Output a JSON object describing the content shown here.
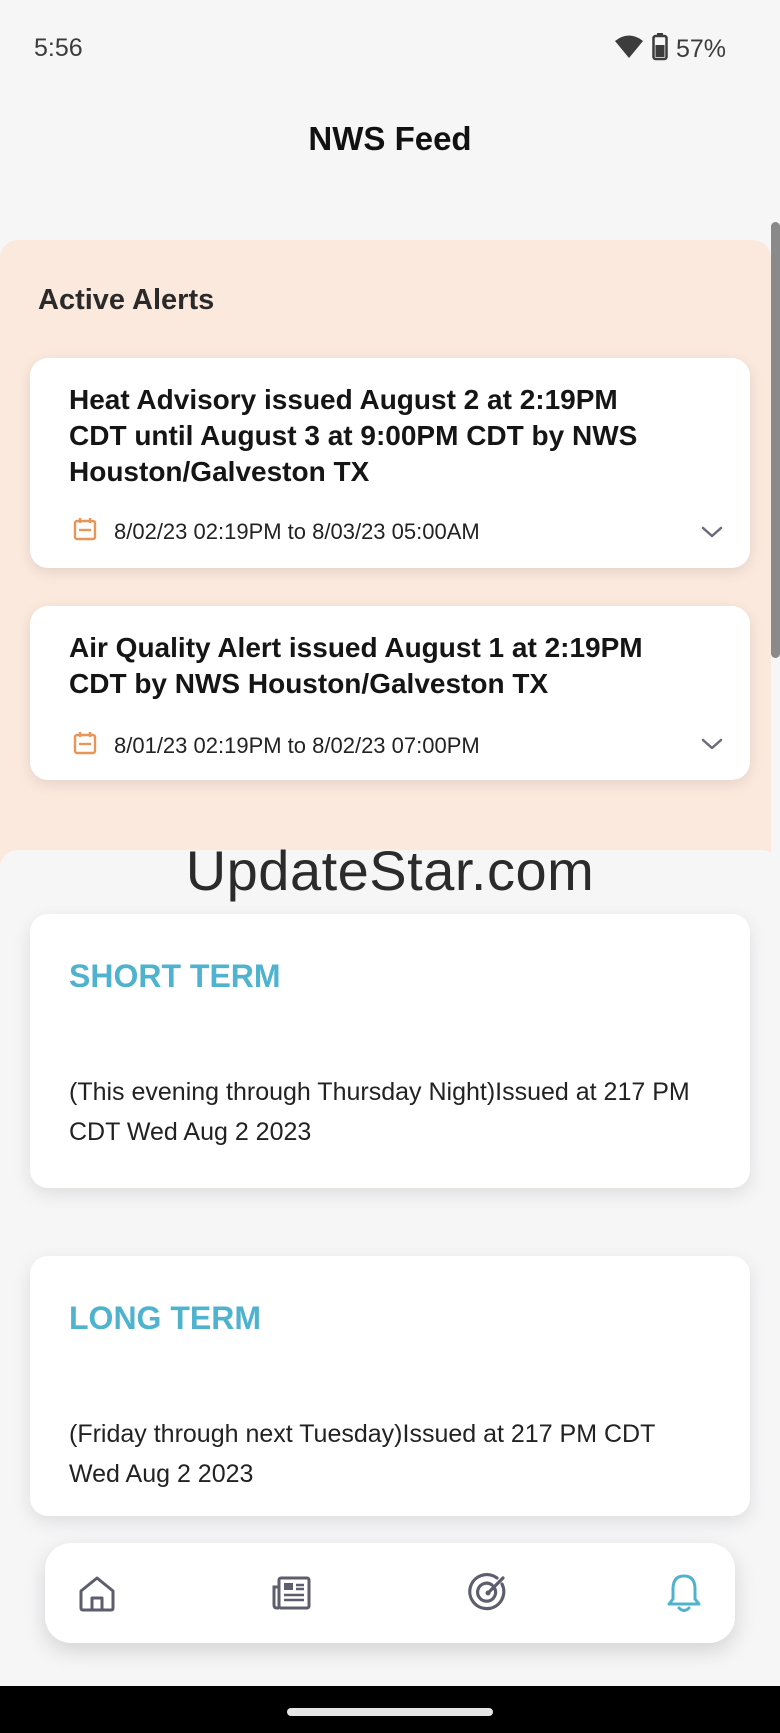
{
  "status_bar": {
    "time": "5:56",
    "battery": "57%"
  },
  "header": {
    "title": "NWS Feed"
  },
  "alerts": {
    "heading": "Active Alerts",
    "items": [
      {
        "title": "Heat Advisory issued August 2 at 2:19PM CDT until August 3 at 9:00PM CDT by NWS Houston/Galveston TX",
        "dates": "8/02/23 02:19PM to 8/03/23 05:00AM"
      },
      {
        "title": "Air Quality Alert issued August 1 at 2:19PM CDT by NWS Houston/Galveston TX",
        "dates": "8/01/23 02:19PM to 8/02/23 07:00PM"
      }
    ]
  },
  "watermark": "UpdateStar.com",
  "forecast": {
    "items": [
      {
        "heading": "SHORT TERM",
        "body": "(This evening through Thursday Night)Issued at 217 PM CDT Wed Aug 2 2023"
      },
      {
        "heading": "LONG TERM",
        "body": "(Friday through next Tuesday)Issued at 217 PM CDT Wed Aug 2 2023"
      }
    ]
  },
  "colors": {
    "accent": "#4fb3cf",
    "alert_bg": "#fce9de",
    "calendar_icon": "#e8955a",
    "nav_icon": "#5d5d6e"
  },
  "bottom_nav": {
    "items": [
      {
        "icon": "home-icon"
      },
      {
        "icon": "newspaper-icon"
      },
      {
        "icon": "radar-icon"
      },
      {
        "icon": "bell-icon",
        "active": true
      }
    ]
  }
}
